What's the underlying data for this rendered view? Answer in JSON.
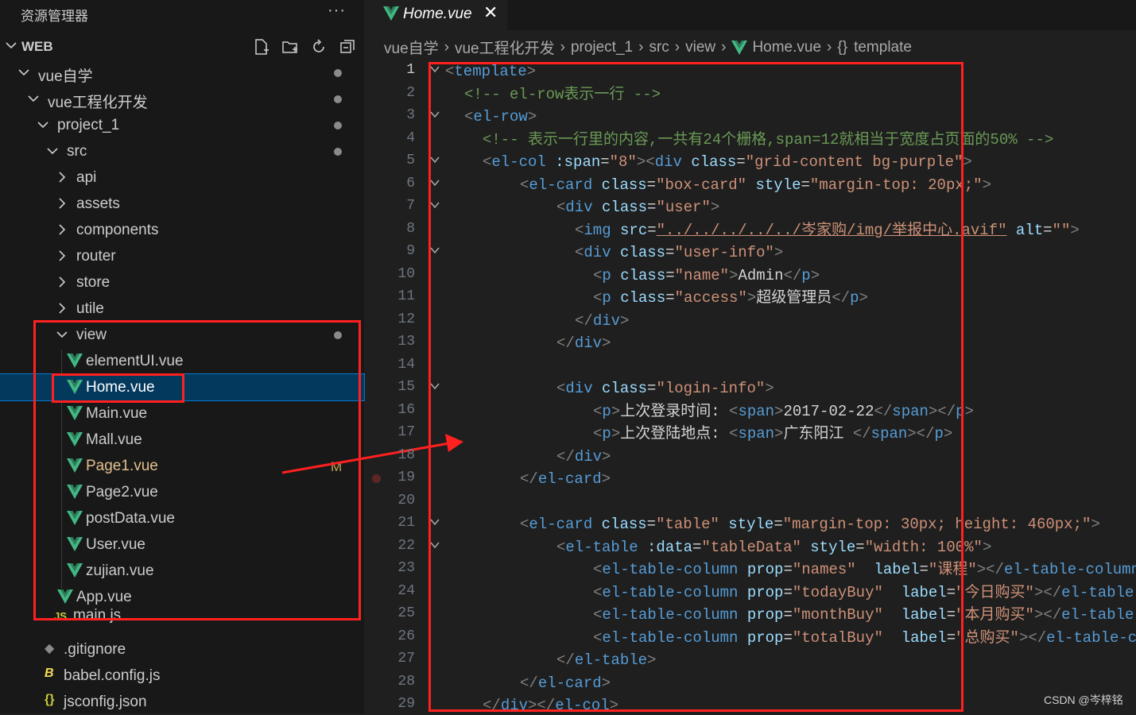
{
  "sidebar": {
    "title": "资源管理器",
    "more": "···",
    "workspace": "WEB",
    "tree": [
      {
        "label": "vue自学",
        "dot": true
      },
      {
        "label": "vue工程化开发",
        "dot": true
      },
      {
        "label": "project_1",
        "dot": true
      },
      {
        "label": "src",
        "dot": true
      },
      {
        "label": "api"
      },
      {
        "label": "assets"
      },
      {
        "label": "components"
      },
      {
        "label": "router"
      },
      {
        "label": "store"
      },
      {
        "label": "utile"
      },
      {
        "label": "view",
        "dot": true
      },
      {
        "label": "elementUI.vue"
      },
      {
        "label": "Home.vue"
      },
      {
        "label": "Main.vue"
      },
      {
        "label": "Mall.vue"
      },
      {
        "label": "Page1.vue",
        "badge": "M"
      },
      {
        "label": "Page2.vue"
      },
      {
        "label": "postData.vue"
      },
      {
        "label": "User.vue"
      },
      {
        "label": "zujian.vue"
      },
      {
        "label": "App.vue"
      },
      {
        "label": "main.js",
        "icon": "JS"
      },
      {
        "label": ".gitignore"
      },
      {
        "label": "babel.config.js"
      },
      {
        "label": "jsconfig.json",
        "icon": "{}"
      }
    ]
  },
  "tab": {
    "label": "Home.vue",
    "close": "✕"
  },
  "breadcrumb": [
    "vue自学",
    "vue工程化开发",
    "project_1",
    "src",
    "view",
    "Home.vue",
    "template"
  ],
  "breadcrumb_braces": "{}",
  "line_numbers": [
    "1",
    "2",
    "3",
    "4",
    "5",
    "6",
    "7",
    "8",
    "9",
    "10",
    "11",
    "12",
    "13",
    "14",
    "15",
    "16",
    "17",
    "18",
    "19",
    "20",
    "21",
    "22",
    "23",
    "24",
    "25",
    "26",
    "27",
    "28",
    "29"
  ],
  "code": {
    "l1": [
      "<",
      "template",
      ">"
    ],
    "l2": "<!-- el-row表示一行 -->",
    "l3": [
      "<",
      "el-row",
      ">"
    ],
    "l4": "<!-- 表示一行里的内容,一共有24个栅格,span=12就相当于宽度占页面的50% -->",
    "l5": {
      "tag": "el-col",
      "attr1": ":span",
      "val1": "\"8\"",
      "tag2": "div",
      "attr2": "class",
      "val2": "\"grid-content bg-purple\""
    },
    "l6": {
      "tag": "el-card",
      "attr1": "class",
      "val1": "\"box-card\"",
      "attr2": "style",
      "val2": "\"margin-top: 20px;\""
    },
    "l7": {
      "tag": "div",
      "attr1": "class",
      "val1": "\"user\""
    },
    "l8": {
      "tag": "img",
      "attr1": "src",
      "val1": "\"../../../../../岑家购/img/举报中心.avif\"",
      "attr2": "alt",
      "val2": "\"\""
    },
    "l9": {
      "tag": "div",
      "attr1": "class",
      "val1": "\"user-info\""
    },
    "l10": {
      "tag": "p",
      "attr1": "class",
      "val1": "\"name\"",
      "text": "Admin"
    },
    "l11": {
      "tag": "p",
      "attr1": "class",
      "val1": "\"access\"",
      "text": "超级管理员"
    },
    "l12": "div",
    "l13": "div",
    "l15": {
      "tag": "div",
      "attr1": "class",
      "val1": "\"login-info\""
    },
    "l16": {
      "text": "上次登录时间: ",
      "inner": "2017-02-22"
    },
    "l17": {
      "text": "上次登陆地点: ",
      "inner": "广东阳江 "
    },
    "l18": "div",
    "l19": "el-card",
    "l21": {
      "tag": "el-card",
      "attr1": "class",
      "val1": "\"table\"",
      "attr2": "style",
      "val2": "\"margin-top: 30px; height: 460px;\""
    },
    "l22": {
      "tag": "el-table",
      "attr1": ":data",
      "val1": "\"tableData\"",
      "attr2": "style",
      "val2": "\"width: 100%\""
    },
    "cols": [
      {
        "prop": "\"names\"",
        "label": "\"课程\""
      },
      {
        "prop": "\"todayBuy\"",
        "label": "\"今日购买\""
      },
      {
        "prop": "\"monthBuy\"",
        "label": "\"本月购买\""
      },
      {
        "prop": "\"totalBuy\"",
        "label": "\"总购买\""
      }
    ],
    "l27": "el-table",
    "l28": "el-card",
    "l29": [
      "div",
      "el-col"
    ]
  },
  "watermark": "CSDN @岑梓铭",
  "colors": {
    "annotation": "#ff2020",
    "selection": "#04395e",
    "vue_green": "#41b883"
  }
}
